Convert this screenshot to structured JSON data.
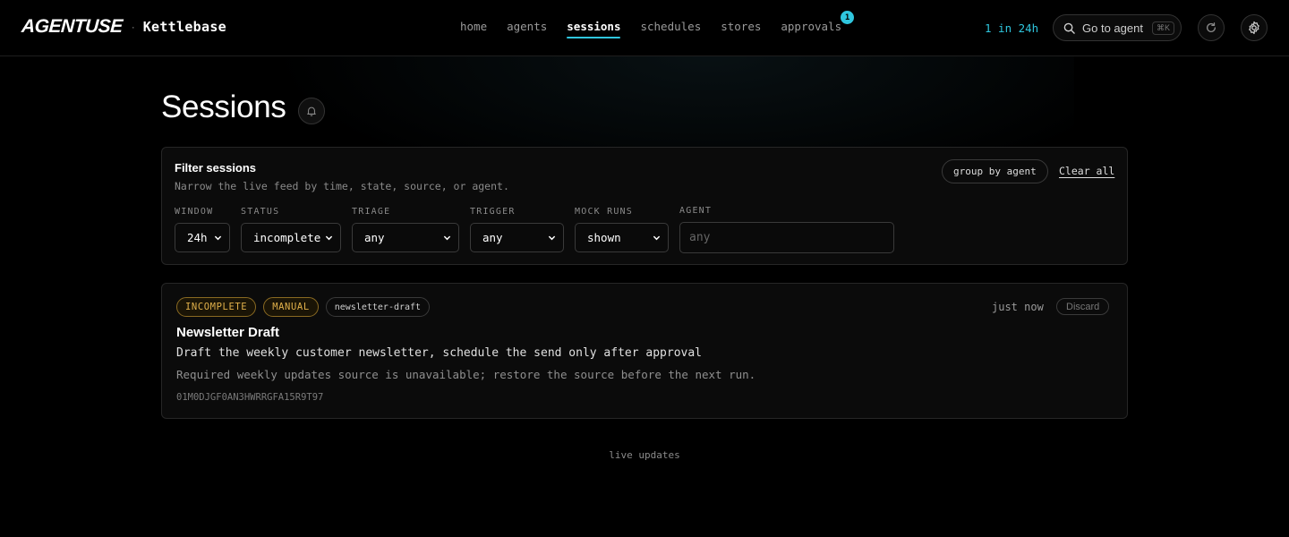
{
  "header": {
    "logo": "AGENTUSE",
    "separator": "·",
    "workspace": "Kettlebase",
    "nav": [
      {
        "label": "home",
        "active": false
      },
      {
        "label": "agents",
        "active": false
      },
      {
        "label": "sessions",
        "active": true
      },
      {
        "label": "schedules",
        "active": false
      },
      {
        "label": "stores",
        "active": false
      },
      {
        "label": "approvals",
        "active": false,
        "badge": "1"
      }
    ],
    "runs_count": "1 in 24h",
    "goto_label": "Go to agent",
    "goto_shortcut": "⌘K",
    "icons": [
      "search-icon",
      "refresh-icon",
      "gear-icon"
    ]
  },
  "page": {
    "title": "Sessions",
    "bell_icon": "bell-icon"
  },
  "filters": {
    "title": "Filter sessions",
    "subtitle": "Narrow the live feed by time, state, source, or agent.",
    "group_button": "group by agent",
    "clear_all": "Clear all",
    "window": {
      "label": "WINDOW",
      "value": "24h"
    },
    "status": {
      "label": "STATUS",
      "value": "incomplete"
    },
    "triage": {
      "label": "TRIAGE",
      "value": "any"
    },
    "trigger": {
      "label": "TRIGGER",
      "value": "any"
    },
    "mock_runs": {
      "label": "MOCK RUNS",
      "value": "shown"
    },
    "agent": {
      "label": "AGENT",
      "value": "",
      "placeholder": "any"
    }
  },
  "sessions": [
    {
      "tags": [
        "INCOMPLETE",
        "MANUAL",
        "newsletter-draft"
      ],
      "time": "just now",
      "discard": "Discard",
      "title": "Newsletter Draft",
      "description": "Draft the weekly customer newsletter, schedule the send only after approval",
      "note": "Required weekly updates source is unavailable; restore the source before the next run.",
      "id": "01M0DJGF0AN3HWRRGFA15R9T97"
    }
  ],
  "footer": {
    "live": "live updates"
  },
  "colors": {
    "accent": "#2fc6de",
    "warning": "#e0b04a",
    "background": "#000000"
  }
}
